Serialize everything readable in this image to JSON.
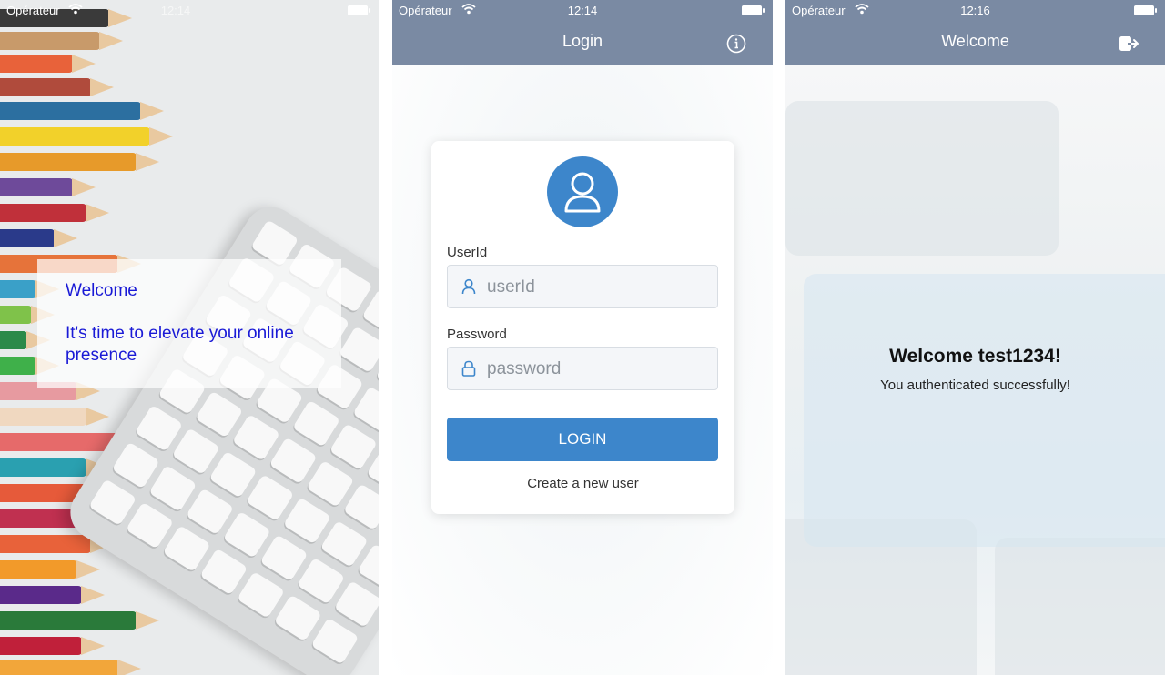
{
  "splash": {
    "status": {
      "carrier": "Opérateur",
      "time": "12:14"
    },
    "overlay": {
      "title": "Welcome",
      "subtitle": "It's time to elevate your online presence"
    }
  },
  "login": {
    "status": {
      "carrier": "Opérateur",
      "time": "12:14"
    },
    "nav": {
      "title": "Login",
      "action_icon": "info-icon"
    },
    "form": {
      "userid_label": "UserId",
      "userid_placeholder": "userId",
      "password_label": "Password",
      "password_placeholder": "password",
      "login_button": "LOGIN",
      "create_link": "Create a new user"
    },
    "accent": "#3d86cb"
  },
  "welcome": {
    "status": {
      "carrier": "Opérateur",
      "time": "12:16"
    },
    "nav": {
      "title": "Welcome",
      "action_icon": "logout-icon"
    },
    "heading": "Welcome test1234!",
    "message": "You authenticated successfully!"
  },
  "colors": {
    "navbar": "#7a8aa3",
    "link_text": "#1a1ad6",
    "button": "#3d86cb"
  }
}
